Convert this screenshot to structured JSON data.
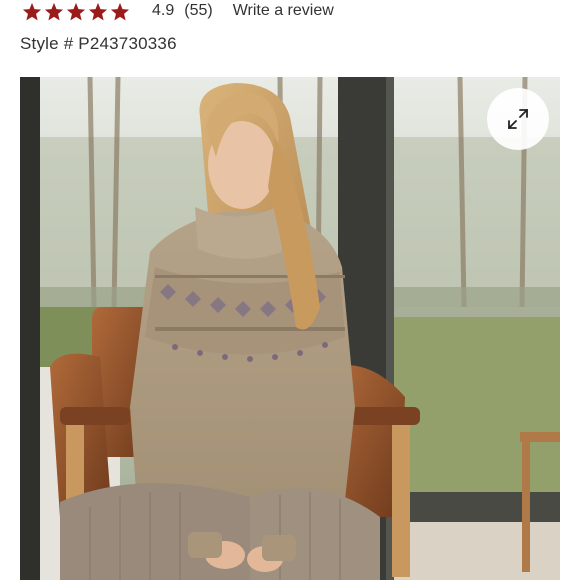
{
  "rating": {
    "stars_filled": 5,
    "stars_total": 5,
    "star_color": "#9b1b1b",
    "value": "4.9",
    "count": "(55)",
    "write_review_label": "Write a review"
  },
  "product": {
    "style_label": "Style # P243730336"
  },
  "gallery": {
    "expand_icon": "expand-arrows-icon"
  }
}
